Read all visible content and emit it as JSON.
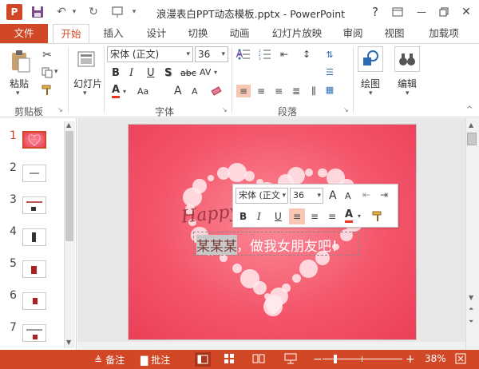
{
  "titlebar": {
    "title": "浪漫表白PPT动态模板.pptx - PowerPoint",
    "help": "?",
    "minimize": "—",
    "close": "✕"
  },
  "tabs": {
    "file": "文件",
    "home": "开始",
    "insert": "插入",
    "design": "设计",
    "transitions": "切换",
    "animations": "动画",
    "slideshow": "幻灯片放映",
    "review": "审阅",
    "view": "视图",
    "addins": "加载项"
  },
  "ribbon": {
    "paste_label": "粘贴",
    "slides_label": "幻灯片",
    "drawing_label": "绘图",
    "editing_label": "编辑",
    "font_name": "宋体 (正文)",
    "font_size": "36",
    "bold": "B",
    "italic": "I",
    "underline": "U",
    "shadow": "S",
    "strike": "abc",
    "spacing": "AV",
    "case": "Aa",
    "grow": "A",
    "shrink": "A",
    "color_a": "A",
    "groups": {
      "clipboard": "剪贴板",
      "font": "字体",
      "paragraph": "段落"
    }
  },
  "thumbnails": {
    "numbers": [
      "1",
      "2",
      "3",
      "4",
      "5",
      "6",
      "7"
    ]
  },
  "slide": {
    "script_text": "Happy",
    "main_text_selected": "某某某",
    "main_text_rest": "，做我女朋友吧！"
  },
  "minibar": {
    "font_name": "宋体 (正文",
    "font_size": "36",
    "bold": "B",
    "italic": "I",
    "underline": "U",
    "grow": "A",
    "shrink": "A",
    "color_a": "A"
  },
  "statusbar": {
    "notes": "备注",
    "comments": "批注",
    "zoom": "38%"
  },
  "colors": {
    "accent": "#d24726",
    "slide_bg": "#f4566b",
    "selection": "#f8c7b4"
  }
}
